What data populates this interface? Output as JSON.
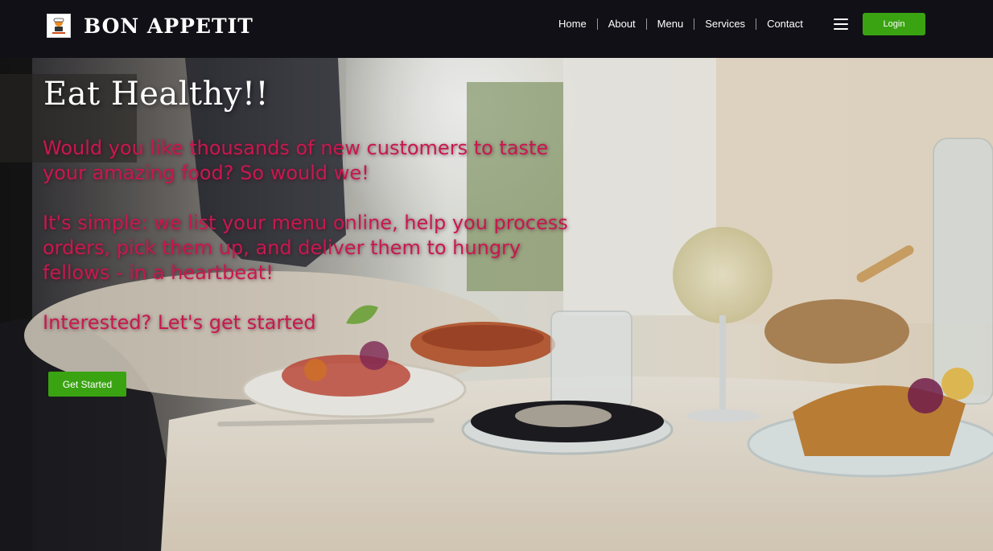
{
  "brand": {
    "name": "BON APPETIT",
    "logo_icon": "chef-logo-icon"
  },
  "nav": {
    "items": [
      {
        "label": "Home"
      },
      {
        "label": "About"
      },
      {
        "label": "Menu"
      },
      {
        "label": "Services"
      },
      {
        "label": "Contact"
      }
    ],
    "menu_icon": "hamburger-menu-icon",
    "login_label": "Login"
  },
  "hero": {
    "title": "Eat Healthy!!",
    "paragraph1": "Would you like thousands of new customers to taste your amazing food? So would we!",
    "paragraph2": "It's simple: we list your menu online, help you process orders, pick them up, and deliver them to hungry fellows - in a heartbeat!",
    "paragraph3": "Interested? Let's get started",
    "cta_label": "Get Started"
  },
  "colors": {
    "header_bg": "#111016",
    "accent_green": "#3aa312",
    "hero_text": "#c8184f",
    "title_text": "#ffffff"
  }
}
